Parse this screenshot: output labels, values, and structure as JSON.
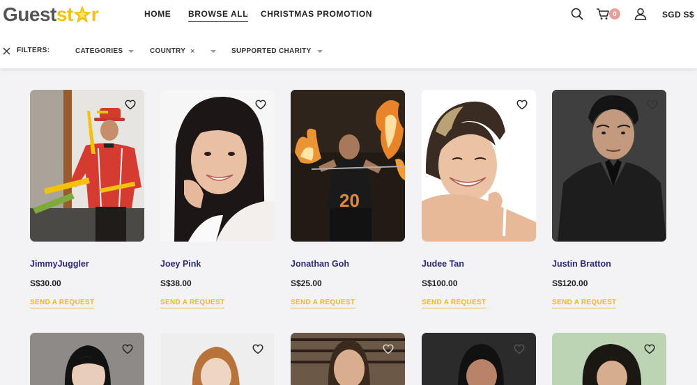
{
  "brand": {
    "name_part1": "Guest",
    "name_part2": "st",
    "name_part3": "r",
    "logo_icon": "star-icon",
    "accent_color": "#f5c10e"
  },
  "nav": {
    "home": "HOME",
    "browse_all": "BROWSE ALL",
    "christmas": "CHRISTMAS PROMOTION"
  },
  "header": {
    "search_icon": "search-icon",
    "cart_icon": "cart-icon",
    "cart_count": "0",
    "account_icon": "user-icon",
    "currency": "SGD S$"
  },
  "filters": {
    "label": "FILTERS:",
    "items": [
      {
        "label": "CATEGORIES"
      },
      {
        "label": "COUNTRY"
      },
      {
        "label": "SUPPORTED CHARITY"
      }
    ]
  },
  "performers": [
    {
      "name": "JimmyJuggler",
      "price": "S$30.00",
      "cta": "SEND A REQUEST"
    },
    {
      "name": "Joey Pink",
      "price": "S$38.00",
      "cta": "SEND A REQUEST"
    },
    {
      "name": "Jonathan Goh",
      "price": "S$25.00",
      "cta": "SEND A REQUEST"
    },
    {
      "name": "Judee Tan",
      "price": "S$100.00",
      "cta": "SEND A REQUEST"
    },
    {
      "name": "Justin Bratton",
      "price": "S$120.00",
      "cta": "SEND A REQUEST"
    }
  ],
  "colors": {
    "name_color": "#2b2a7c",
    "cta_color": "#f0b52a",
    "cart_badge": "#e4a09a"
  }
}
